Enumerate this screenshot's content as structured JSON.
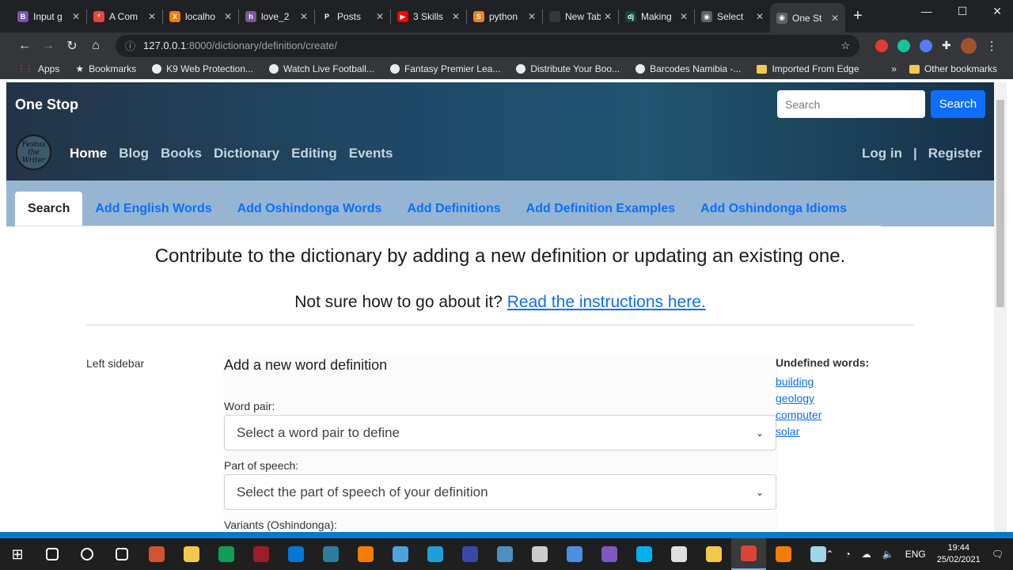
{
  "browser": {
    "tabs": [
      {
        "label": "Input g",
        "icon": "bootstrap-icon",
        "color": "#7952b3",
        "glyph": "B"
      },
      {
        "label": "A Com",
        "icon": "asterisk-icon",
        "color": "#e8453c",
        "glyph": "*"
      },
      {
        "label": "localho",
        "icon": "xampp-icon",
        "color": "#f57c00",
        "glyph": "X"
      },
      {
        "label": "love_2",
        "icon": "heroku-icon",
        "color": "#79589f",
        "glyph": "h"
      },
      {
        "label": "Posts",
        "icon": "posts-icon",
        "color": "#202124",
        "glyph": "P"
      },
      {
        "label": "3 Skills",
        "icon": "youtube-icon",
        "color": "#ff0000",
        "glyph": "▶"
      },
      {
        "label": "python",
        "icon": "stackoverflow-icon",
        "color": "#f48024",
        "glyph": "S"
      },
      {
        "label": "New Tab",
        "icon": "newtab-icon",
        "color": "#35363a",
        "glyph": ""
      },
      {
        "label": "Making",
        "icon": "django-icon",
        "color": "#0c4b33",
        "glyph": "dj"
      },
      {
        "label": "Select",
        "icon": "globe-icon",
        "color": "#5f6368",
        "glyph": "◉"
      },
      {
        "label": "One St",
        "icon": "globe-icon",
        "color": "#5f6368",
        "glyph": "◉",
        "active": true
      }
    ],
    "new_tab_symbol": "+",
    "window_controls": [
      "—",
      "☐",
      "✕"
    ],
    "url_host": "127.0.0.1",
    "url_path": ":8000/dictionary/definition/create/",
    "bookmarks": [
      {
        "label": "Apps",
        "kind": "apps"
      },
      {
        "label": "Bookmarks",
        "kind": "star"
      },
      {
        "label": "K9 Web Protection...",
        "kind": "globe"
      },
      {
        "label": "Watch Live Football...",
        "kind": "globe"
      },
      {
        "label": "Fantasy Premier Lea...",
        "kind": "globe"
      },
      {
        "label": "Distribute Your Boo...",
        "kind": "globe"
      },
      {
        "label": "Barcodes Namibia -...",
        "kind": "globe"
      },
      {
        "label": "Imported From Edge",
        "kind": "folder"
      }
    ],
    "bookmarks_overflow": "»",
    "other_bookmarks": "Other bookmarks"
  },
  "site": {
    "brand": "One Stop",
    "search_placeholder": "Search",
    "search_button": "Search",
    "logo_text": "Festus the Writer",
    "nav": [
      {
        "label": "Home",
        "active": true
      },
      {
        "label": "Blog"
      },
      {
        "label": "Books"
      },
      {
        "label": "Dictionary"
      },
      {
        "label": "Editing"
      },
      {
        "label": "Events"
      }
    ],
    "auth": {
      "login": "Log in",
      "separator": "|",
      "register": "Register"
    },
    "subnav": [
      {
        "label": "Search",
        "active": true
      },
      {
        "label": "Add English Words"
      },
      {
        "label": "Add Oshindonga Words"
      },
      {
        "label": "Add Definitions"
      },
      {
        "label": "Add Definition Examples"
      },
      {
        "label": "Add Oshindonga Idioms"
      }
    ]
  },
  "page": {
    "heading": "Contribute to the dictionary by adding a new definition or updating an existing one.",
    "help_prefix": "Not sure how to go about it?",
    "help_link": "Read the instructions here.",
    "left_sidebar": "Left sidebar",
    "form": {
      "title": "Add a new word definition",
      "word_pair_label": "Word pair:",
      "word_pair_placeholder": "Select a word pair to define",
      "pos_label": "Part of speech:",
      "pos_placeholder": "Select the part of speech of your definition",
      "variants_label": "Variants (Oshindonga):"
    },
    "undefined_words": {
      "heading": "Undefined words:",
      "words": [
        "building",
        "geology",
        "computer",
        "solar"
      ]
    }
  },
  "taskbar": {
    "time": "19:44",
    "date": "25/02/2021",
    "language": "ENG",
    "apps": [
      {
        "name": "search-taskbar-icon",
        "color": "#ffffff"
      },
      {
        "name": "cortana-icon",
        "color": "#ffffff"
      },
      {
        "name": "task-view-icon",
        "color": "#ffffff"
      },
      {
        "name": "powerpoint-icon",
        "color": "#d35230"
      },
      {
        "name": "file-explorer-icon",
        "color": "#f2c94c"
      },
      {
        "name": "edge-icon",
        "color": "#0f9d58"
      },
      {
        "name": "mendeley-icon",
        "color": "#9c1d27"
      },
      {
        "name": "vscode-icon",
        "color": "#0078d4"
      },
      {
        "name": "terminal-icon",
        "color": "#2d7d9a"
      },
      {
        "name": "vlc-icon",
        "color": "#f57c00"
      },
      {
        "name": "notepad-icon",
        "color": "#4aa3df"
      },
      {
        "name": "photos-icon",
        "color": "#1ca0d8"
      },
      {
        "name": "snipping-icon",
        "color": "#3949ab"
      },
      {
        "name": "globe-app-icon",
        "color": "#4a90c2"
      },
      {
        "name": "sublime-icon",
        "color": "#cccccc"
      },
      {
        "name": "mail-icon",
        "color": "#4a90e2"
      },
      {
        "name": "tor-icon",
        "color": "#7e57c2"
      },
      {
        "name": "skype-icon",
        "color": "#00aff0"
      },
      {
        "name": "reader-icon",
        "color": "#e0e0e0"
      },
      {
        "name": "sticky-icon",
        "color": "#f2c94c"
      },
      {
        "name": "chrome-icon",
        "color": "#db4437"
      },
      {
        "name": "xampp-app-icon",
        "color": "#f57c00"
      },
      {
        "name": "notes-icon",
        "color": "#a0d4e8"
      }
    ]
  }
}
